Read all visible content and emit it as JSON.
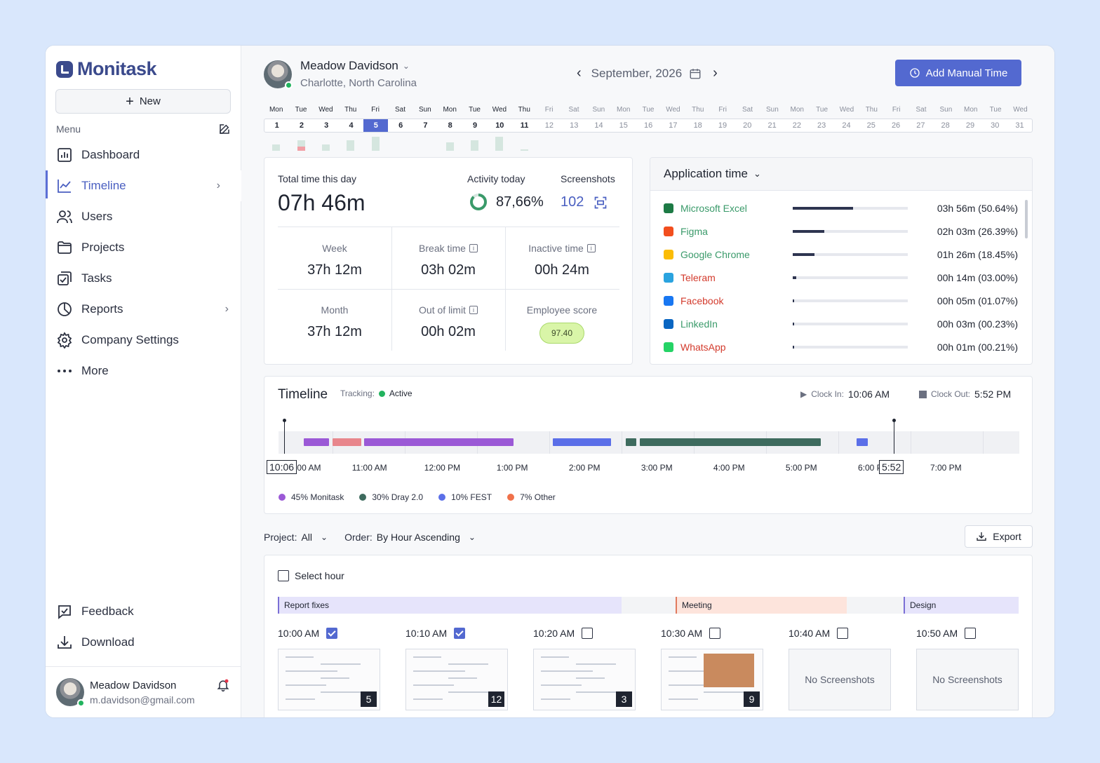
{
  "brand": "Monitask",
  "sidebar": {
    "new_label": "New",
    "menu_label": "Menu",
    "items": [
      {
        "label": "Dashboard",
        "icon": "chart-bar-icon"
      },
      {
        "label": "Timeline",
        "icon": "trend-line-icon"
      },
      {
        "label": "Users",
        "icon": "users-icon"
      },
      {
        "label": "Projects",
        "icon": "folder-icon"
      },
      {
        "label": "Tasks",
        "icon": "tasks-icon"
      },
      {
        "label": "Reports",
        "icon": "pie-chart-icon"
      },
      {
        "label": "Company Settings",
        "icon": "gear-icon"
      },
      {
        "label": "More",
        "icon": "more-icon"
      }
    ],
    "bottom": [
      {
        "label": "Feedback",
        "icon": "feedback-icon"
      },
      {
        "label": "Download",
        "icon": "download-icon"
      }
    ],
    "user": {
      "name": "Meadow Davidson",
      "email": "m.davidson@gmail.com"
    }
  },
  "header": {
    "user_name": "Meadow Davidson",
    "location": "Charlotte, North Carolina",
    "month": "September, 2026",
    "add_manual_time": "Add Manual Time"
  },
  "calendar": {
    "days": [
      "Mon",
      "Tue",
      "Wed",
      "Thu",
      "Fri",
      "Sat",
      "Sun",
      "Mon",
      "Tue",
      "Wed",
      "Thu",
      "Fri",
      "Sat",
      "Sun",
      "Mon",
      "Tue",
      "Wed",
      "Thu",
      "Fri",
      "Sat",
      "Sun",
      "Mon",
      "Tue",
      "Wed",
      "Thu",
      "Fri",
      "Sat",
      "Sun",
      "Mon",
      "Tue",
      "Wed"
    ],
    "dates": [
      "1",
      "2",
      "3",
      "4",
      "5",
      "6",
      "7",
      "8",
      "9",
      "10",
      "11",
      "12",
      "13",
      "14",
      "15",
      "16",
      "17",
      "18",
      "19",
      "20",
      "21",
      "22",
      "23",
      "24",
      "25",
      "26",
      "27",
      "28",
      "29",
      "30",
      "31"
    ],
    "selected": "5",
    "active_through": "11",
    "activity_levels": [
      0.45,
      0.75,
      0.45,
      0.75,
      1.0,
      0,
      0,
      0.6,
      0.75,
      1.0,
      0.1,
      0,
      0,
      0,
      0,
      0,
      0,
      0,
      0,
      0,
      0,
      0,
      0,
      0,
      0,
      0,
      0,
      0,
      0,
      0,
      0
    ]
  },
  "stats": {
    "total_label": "Total time this day",
    "total": "07h 46m",
    "activity_label": "Activity today",
    "activity": "87,66%",
    "screenshots_label": "Screenshots",
    "screenshots": "102",
    "cells": [
      {
        "label": "Week",
        "value": "37h 12m"
      },
      {
        "label": "Break time",
        "value": "03h 02m"
      },
      {
        "label": "Inactive time",
        "value": "00h 24m"
      },
      {
        "label": "Month",
        "value": "37h 12m"
      },
      {
        "label": "Out of limit",
        "value": "00h 02m"
      },
      {
        "label": "Employee score",
        "value": "97.40"
      }
    ]
  },
  "apps": {
    "title": "Application time",
    "rows": [
      {
        "name": "Microsoft Excel",
        "time": "03h 56m (50.64%)",
        "pct": 0.5064,
        "color": "#3a9a6a",
        "icon_color": "#1d7a45"
      },
      {
        "name": "Figma",
        "time": "02h 03m (26.39%)",
        "pct": 0.2639,
        "color": "#3a9a6a",
        "icon_color": "#f24e1e"
      },
      {
        "name": "Google Chrome",
        "time": "01h 26m (18.45%)",
        "pct": 0.1845,
        "color": "#3a9a6a",
        "icon_color": "#fbbc05"
      },
      {
        "name": "Teleram",
        "time": "00h 14m (03.00%)",
        "pct": 0.03,
        "color": "#d33a2c",
        "icon_color": "#2aa3df"
      },
      {
        "name": "Facebook",
        "time": "00h 05m (01.07%)",
        "pct": 0.0107,
        "color": "#d33a2c",
        "icon_color": "#1877f2"
      },
      {
        "name": "LinkedIn",
        "time": "00h 03m (00.23%)",
        "pct": 0.0023,
        "color": "#3a9a6a",
        "icon_color": "#0a66c2"
      },
      {
        "name": "WhatsApp",
        "time": "00h 01m (00.21%)",
        "pct": 0.0021,
        "color": "#d33a2c",
        "icon_color": "#25d366"
      }
    ]
  },
  "timeline": {
    "title": "Timeline",
    "tracking_label": "Tracking:",
    "tracking": "Active",
    "clock_in_label": "Clock In:",
    "clock_in": "10:06 AM",
    "clock_out_label": "Clock Out:",
    "clock_out": "5:52 PM",
    "start_marker": "10:06",
    "end_marker": "5:52",
    "hours": [
      "10:00 AM",
      "11:00 AM",
      "12:00 PM",
      "1:00 PM",
      "2:00 PM",
      "3:00 PM",
      "4:00 PM",
      "5:00 PM",
      "6:00 PM",
      "7:00 PM"
    ],
    "segments": [
      {
        "start": 10.1,
        "end": 10.45,
        "color": "#9b59d6"
      },
      {
        "start": 10.5,
        "end": 10.9,
        "color": "#e8868c"
      },
      {
        "start": 10.93,
        "end": 13.0,
        "color": "#9b59d6"
      },
      {
        "start": 13.55,
        "end": 14.35,
        "color": "#5b6fe8"
      },
      {
        "start": 14.55,
        "end": 14.7,
        "color": "#3e6b5e"
      },
      {
        "start": 14.75,
        "end": 17.25,
        "color": "#3e6b5e"
      },
      {
        "start": 17.75,
        "end": 17.9,
        "color": "#5b6fe8"
      }
    ],
    "legend": [
      {
        "label": "45% Monitask",
        "color": "#9b59d6"
      },
      {
        "label": "30% Dray 2.0",
        "color": "#3e6b5e"
      },
      {
        "label": "10% FEST",
        "color": "#5b6fe8"
      },
      {
        "label": "7% Other",
        "color": "#f0714a"
      }
    ]
  },
  "filters": {
    "project_label": "Project:",
    "project": "All",
    "order_label": "Order:",
    "order": "By Hour Ascending",
    "export": "Export"
  },
  "screens": {
    "select_hour": "Select hour",
    "projects": [
      {
        "label": "Report fixes",
        "color": "#e6e4fb",
        "border": "#7b6fd6"
      },
      {
        "label": "Meeting",
        "color": "#fde4dc",
        "border": "#e07a5f"
      },
      {
        "label": "Design",
        "color": "#e6e4fb",
        "border": "#7b6fd6"
      }
    ],
    "slots": [
      {
        "time": "10:00 AM",
        "checked": true,
        "count": "5"
      },
      {
        "time": "10:10 AM",
        "checked": true,
        "count": "12"
      },
      {
        "time": "10:20 AM",
        "checked": false,
        "count": "3"
      },
      {
        "time": "10:30 AM",
        "checked": false,
        "count": "9"
      },
      {
        "time": "10:40 AM",
        "checked": false,
        "empty": "No Screenshots"
      },
      {
        "time": "10:50 AM",
        "checked": false,
        "empty": "No Screenshots"
      }
    ]
  }
}
